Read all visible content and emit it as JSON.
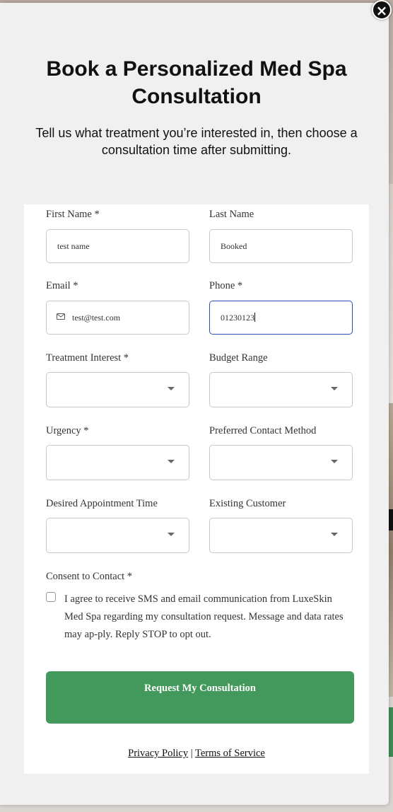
{
  "modal": {
    "title": "Book a Personalized Med Spa Consultation",
    "subtitle": "Tell us what treatment you’re interested in, then choose a consultation time after submitting.",
    "close_icon": "×"
  },
  "form": {
    "first_name": {
      "label": "First Name *",
      "value": "test name"
    },
    "last_name": {
      "label": "Last Name",
      "value": "Booked"
    },
    "email": {
      "label": "Email *",
      "value": "test@test.com",
      "icon": "mail-icon"
    },
    "phone": {
      "label": "Phone *",
      "value": "01230123"
    },
    "treatment_interest": {
      "label": "Treatment Interest *",
      "value": ""
    },
    "budget_range": {
      "label": "Budget Range",
      "value": ""
    },
    "urgency": {
      "label": "Urgency *",
      "value": ""
    },
    "preferred_contact": {
      "label": "Preferred Contact Method",
      "value": ""
    },
    "desired_time": {
      "label": "Desired Appointment Time",
      "value": ""
    },
    "existing_customer": {
      "label": "Existing Customer",
      "value": ""
    },
    "consent": {
      "label": "Consent to Contact *",
      "text": "I agree to receive SMS and email communication from LuxeSkin Med Spa regarding my consultation request. Message and data rates may ap-ply. Reply STOP to opt out.",
      "checked": false
    },
    "submit_label": "Request My Consultation",
    "privacy_label": "Privacy Policy",
    "separator": "|",
    "terms_label": "Terms of Service"
  },
  "colors": {
    "accent_green": "#43985c",
    "focus_blue": "#2d4fb5"
  }
}
